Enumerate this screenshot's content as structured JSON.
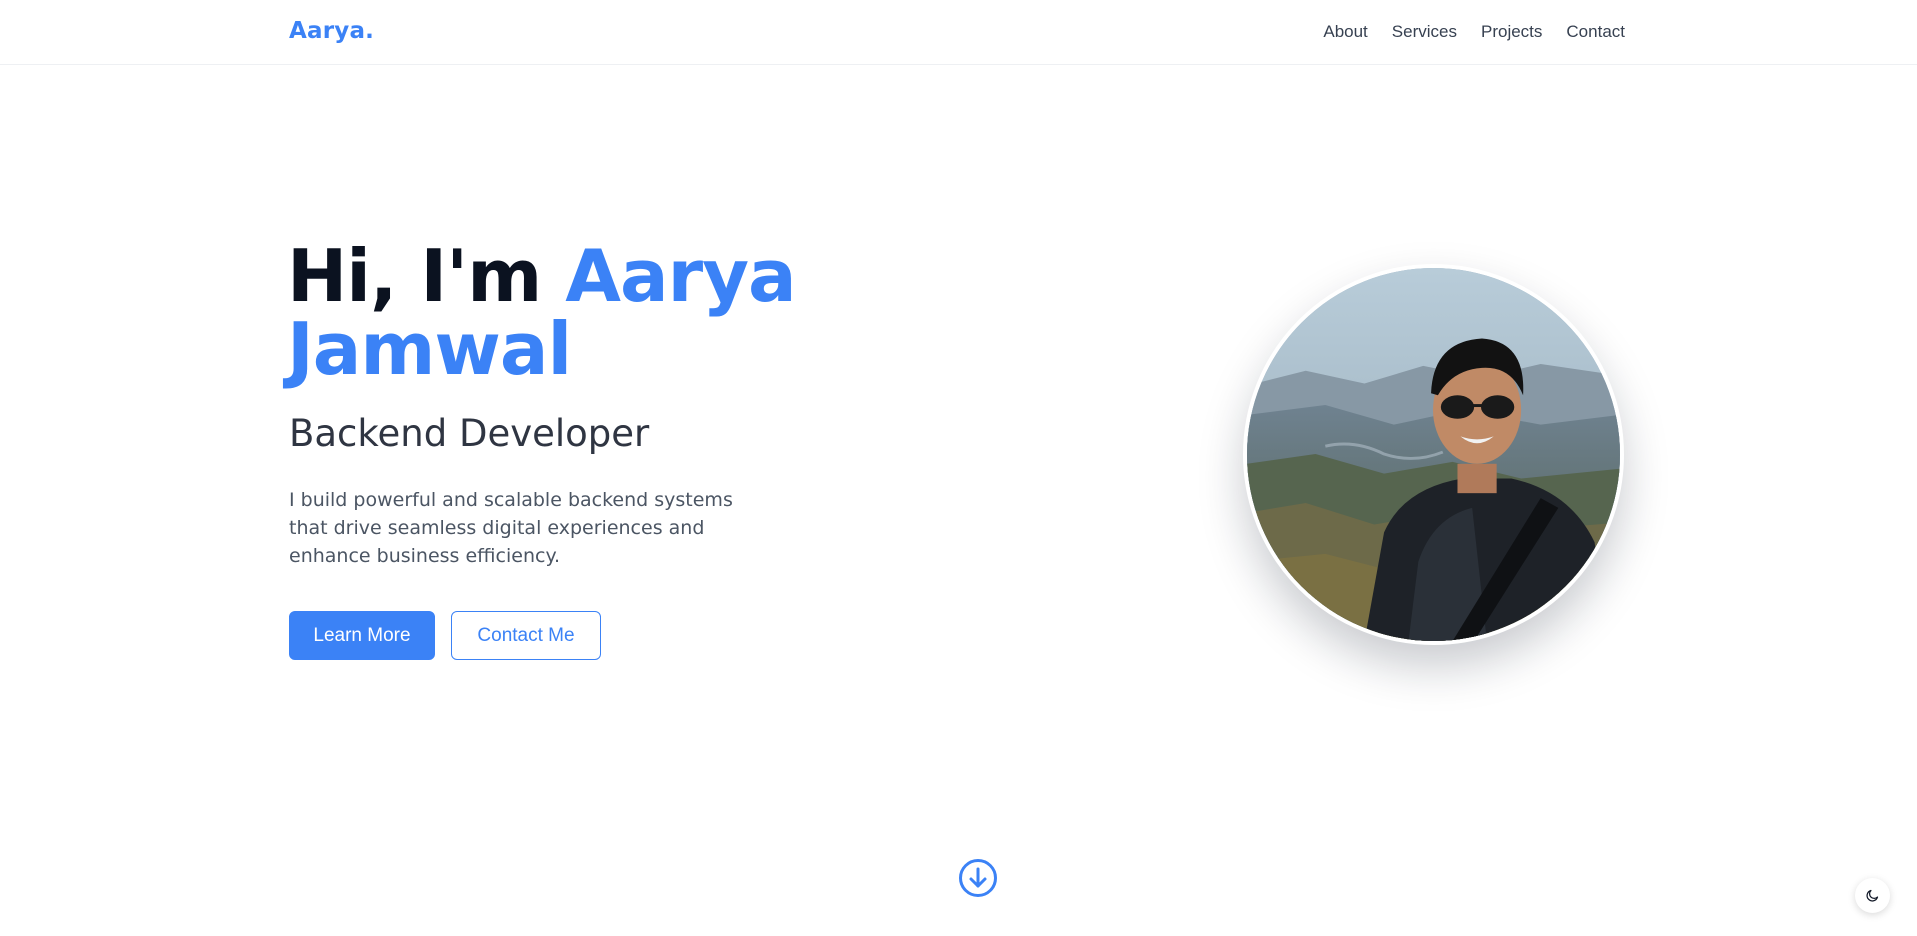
{
  "header": {
    "logo": "Aarya.",
    "nav": [
      "About",
      "Services",
      "Projects",
      "Contact"
    ]
  },
  "hero": {
    "greeting": "Hi, I'm",
    "first_name": "Aarya",
    "last_name": "Jamwal",
    "role": "Backend Developer",
    "description": "I build powerful and scalable backend systems that drive seamless digital experiences and enhance business efficiency.",
    "primary_button": "Learn More",
    "secondary_button": "Contact Me"
  },
  "icons": {
    "scroll_down": "arrow-down-circle-icon",
    "theme_toggle": "moon-icon"
  },
  "colors": {
    "accent": "#3b82f6",
    "heading": "#0b1220",
    "body_text": "#4b5563"
  }
}
